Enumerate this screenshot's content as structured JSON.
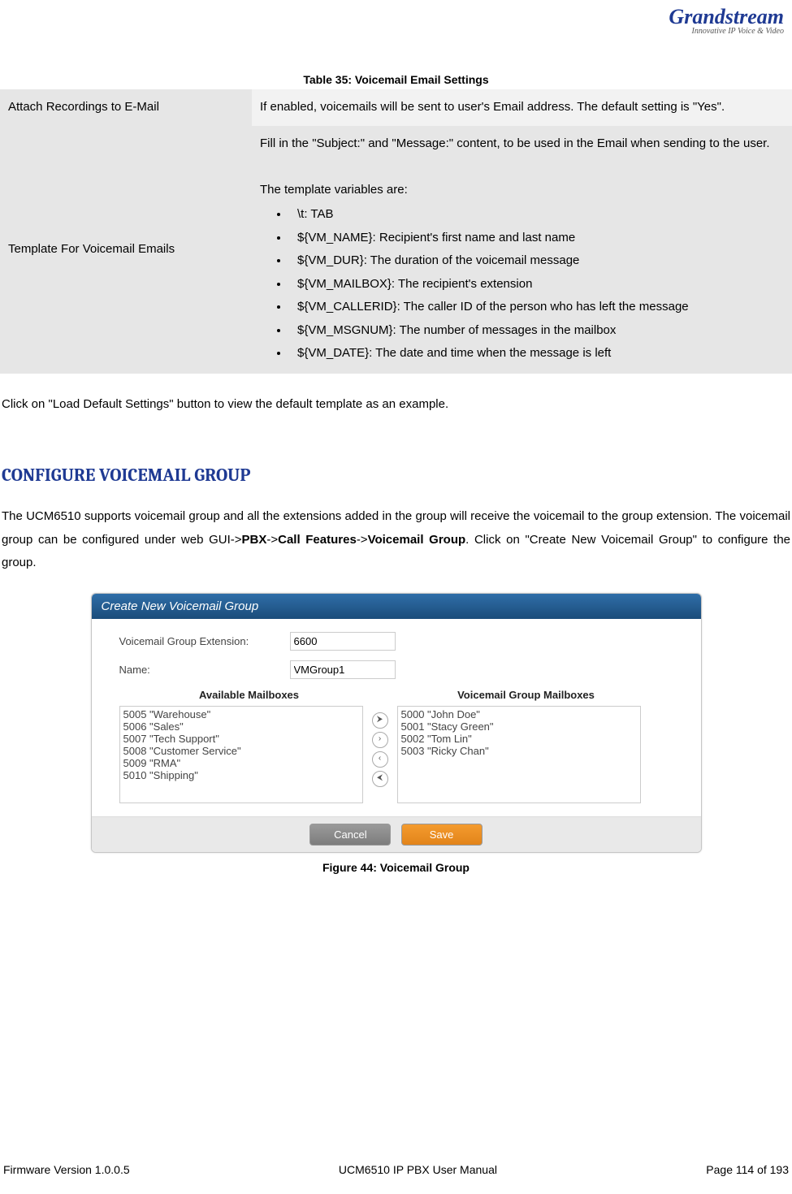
{
  "logo": {
    "main": "Grandstream",
    "sub": "Innovative IP Voice & Video"
  },
  "table_caption": "Table 35: Voicemail Email Settings",
  "rows": [
    {
      "label": "Attach Recordings to E-Mail",
      "desc": "If enabled, voicemails will be sent to user's Email address. The default setting is \"Yes\"."
    },
    {
      "label": "Template For Voicemail Emails",
      "intro1": "Fill in the \"Subject:\" and \"Message:\" content, to be used in the Email when sending to the user.",
      "intro2": "The template variables are:",
      "bullets": [
        "\\t: TAB",
        "${VM_NAME}: Recipient's first name and last name",
        "${VM_DUR}: The duration of the voicemail message",
        "${VM_MAILBOX}: The recipient's extension",
        "${VM_CALLERID}: The caller ID of the person who has left the message",
        "${VM_MSGNUM}: The number of messages in the mailbox",
        "${VM_DATE}: The date and time when the message is left"
      ]
    }
  ],
  "after_table_text": "Click on \"Load Default Settings\" button to view the default template as an example.",
  "section_heading": "CONFIGURE VOICEMAIL GROUP",
  "section_para_pre": "The UCM6510 supports voicemail group and all the extensions added in the group will receive the voicemail to the group extension. The voicemail group can be configured under web GUI->",
  "section_para_b1": "PBX",
  "section_para_mid": "->",
  "section_para_b2": "Call Features",
  "section_para_mid2": "->",
  "section_para_b3": "Voicemail Group",
  "section_para_post": ". Click on \"Create New Voicemail Group\" to configure the group.",
  "dialog": {
    "title": "Create New Voicemail Group",
    "ext_label": "Voicemail Group Extension:",
    "ext_value": "6600",
    "name_label": "Name:",
    "name_value": "VMGroup1",
    "avail_header": "Available Mailboxes",
    "group_header": "Voicemail Group Mailboxes",
    "available": [
      "5005 \"Warehouse\"",
      "5006 \"Sales\"",
      "5007 \"Tech Support\"",
      "5008 \"Customer Service\"",
      "5009 \"RMA\"",
      "5010 \"Shipping\""
    ],
    "group": [
      "5000 \"John Doe\"",
      "5001 \"Stacy Green\"",
      "5002 \"Tom Lin\"",
      "5003 \"Ricky Chan\""
    ],
    "cancel": "Cancel",
    "save": "Save"
  },
  "figure_caption": "Figure 44: Voicemail Group",
  "footer": {
    "left": "Firmware Version 1.0.0.5",
    "center": "UCM6510 IP PBX User Manual",
    "right": "Page 114 of 193"
  }
}
